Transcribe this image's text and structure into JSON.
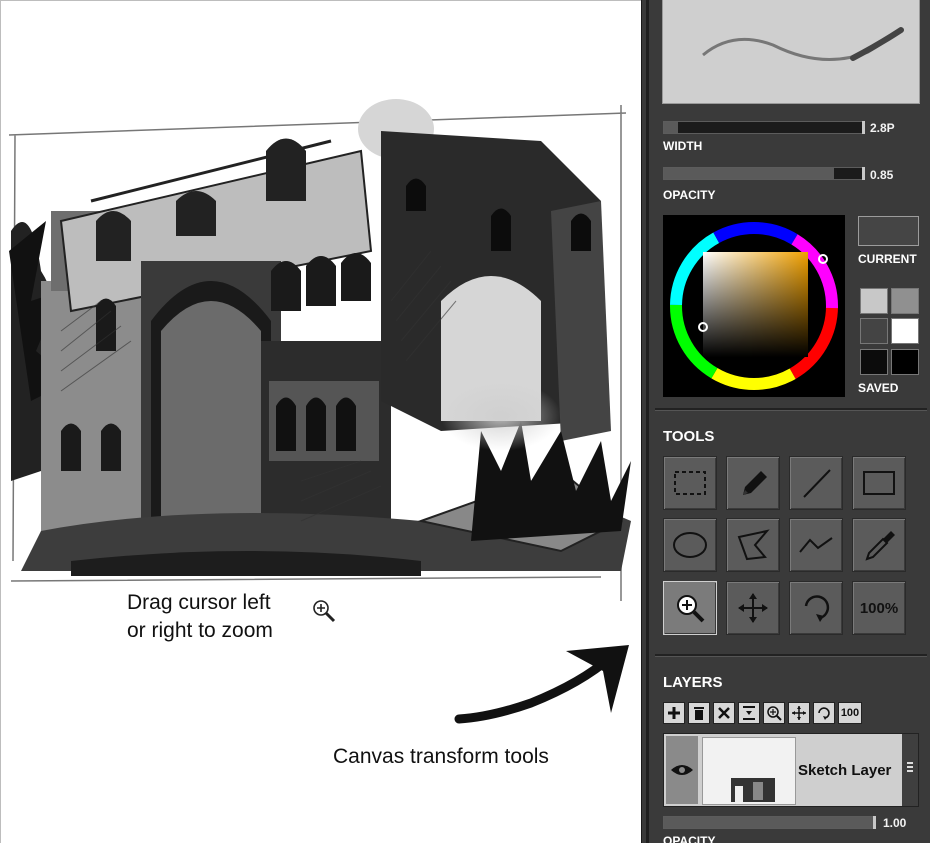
{
  "canvas": {
    "annotations": {
      "zoom_hint_line1": "Drag cursor left",
      "zoom_hint_line2": "or right to zoom",
      "transform_hint": "Canvas transform tools"
    }
  },
  "panel": {
    "width": {
      "label": "WIDTH",
      "value": "2.8P",
      "fraction": 0.07
    },
    "opacity": {
      "label": "OPACITY",
      "value": "0.85",
      "fraction": 0.85
    },
    "color": {
      "current_label": "CURRENT",
      "saved_label": "SAVED",
      "current_color": "#454545",
      "saved_colors": [
        "#c8c8c8",
        "#909090",
        "#444444",
        "#ffffff",
        "#0c0c0c",
        "#000000"
      ]
    },
    "tools": {
      "title": "TOOLS",
      "items": [
        {
          "icon": "rectangle-select-icon"
        },
        {
          "icon": "pencil-icon"
        },
        {
          "icon": "line-icon"
        },
        {
          "icon": "rectangle-icon"
        },
        {
          "icon": "ellipse-icon"
        },
        {
          "icon": "polygon-icon"
        },
        {
          "icon": "polyline-icon"
        },
        {
          "icon": "eyedropper-icon"
        },
        {
          "icon": "zoom-icon",
          "active": true
        },
        {
          "icon": "move-icon"
        },
        {
          "icon": "rotate-icon"
        },
        {
          "icon": "actual-size-icon",
          "label": "100%"
        }
      ]
    },
    "layers": {
      "title": "LAYERS",
      "toolbar_100": "100",
      "layer_name": "Sketch Layer",
      "opacity_value": "1.00",
      "opacity_label": "OPACITY"
    }
  }
}
